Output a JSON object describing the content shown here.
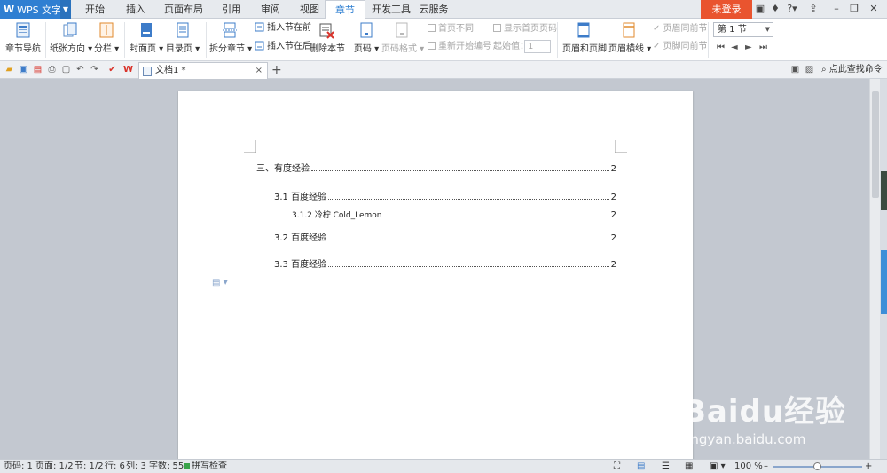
{
  "app": {
    "logo": "W",
    "name": "WPS 文字"
  },
  "menu_tabs": [
    "开始",
    "插入",
    "页面布局",
    "引用",
    "审阅",
    "视图",
    "章节",
    "开发工具",
    "云服务"
  ],
  "active_tab": "章节",
  "login_label": "未登录",
  "help_label": "?",
  "ribbon": {
    "section_nav": "章节导航",
    "paper_orientation": "纸张方向",
    "columns": "分栏",
    "cover_page": "封面页",
    "toc_page": "目录页",
    "split_section": "拆分章节",
    "insert_before": "插入节在前",
    "insert_after": "插入节在后",
    "delete_section": "删除本节",
    "page_number": "页码",
    "page_number_format": "页码格式",
    "different_first_page": "首页不同",
    "show_first_page_number": "显示首页页码",
    "restart_numbering": "重新开始编号",
    "start_value_label": "起始值：",
    "start_value": "1",
    "header_footer": "页眉和页脚",
    "header_line": "页眉横线",
    "same_header_as_prev": "页眉同前节",
    "same_footer_as_prev": "页脚同前节",
    "section_selected": "第 1 节"
  },
  "doc_tab": {
    "title": "文档1 *",
    "close": "×",
    "new": "+"
  },
  "find_command": "点此查找命令",
  "toc": [
    {
      "text": "三、有度经验",
      "page": "2",
      "level": 0
    },
    {
      "text": "3.1 百度经验",
      "page": "2",
      "level": 1
    },
    {
      "text": "3.1.2 冷柠 Cold_Lemon",
      "page": "2",
      "level": 2
    },
    {
      "text": "3.2 百度经验",
      "page": "2",
      "level": 1
    },
    {
      "text": "3.3 百度经验",
      "page": "2",
      "level": 1
    }
  ],
  "status": {
    "page_code": "页码: 1",
    "pages": "页面: 1/2",
    "section": "节: 1/2",
    "row": "行: 6",
    "col": "列: 3",
    "word_count": "字数: 55",
    "spell_check": "拼写检查",
    "zoom": "100 %"
  },
  "watermark": {
    "logo": "Baidu经验",
    "url": "jingyan.baidu.com"
  },
  "colors": {
    "accent": "#2f7fd2",
    "login": "#e9542f"
  }
}
